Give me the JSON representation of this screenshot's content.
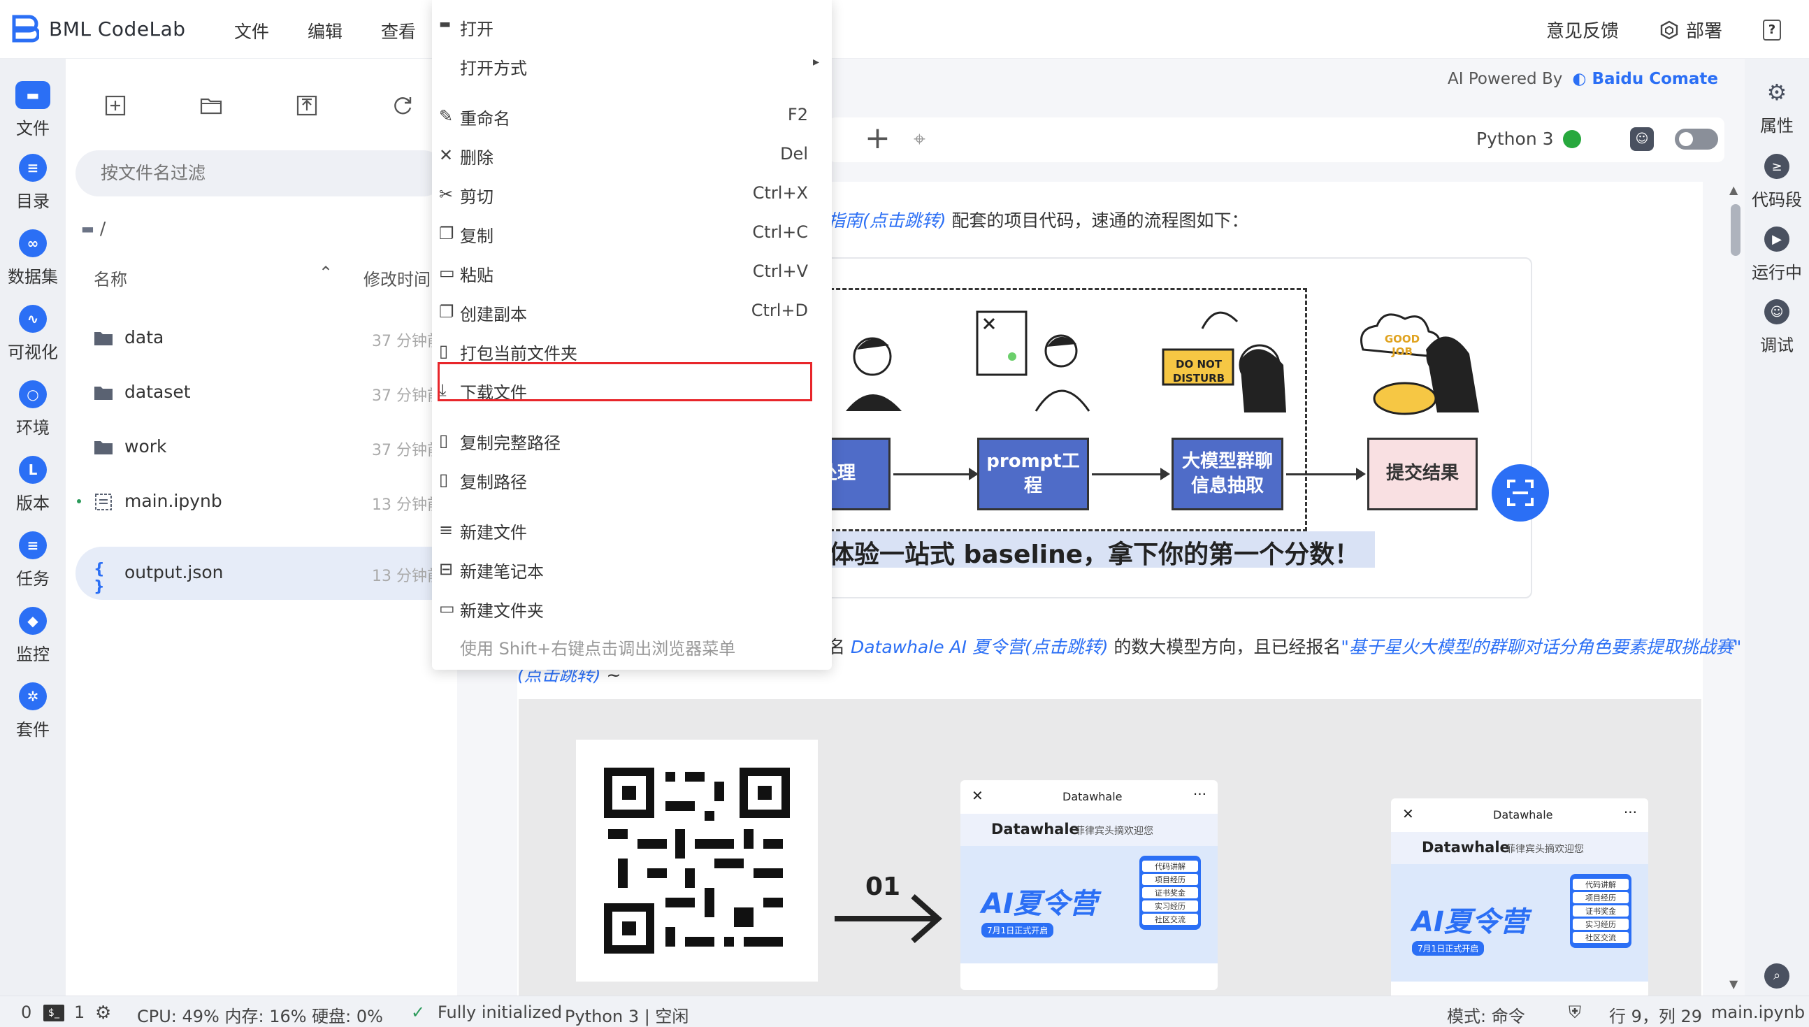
{
  "app": {
    "title": "BML CodeLab"
  },
  "top_menu": [
    "文件",
    "编辑",
    "查看"
  ],
  "top_right": {
    "feedback": "意见反馈",
    "deploy": "部署",
    "help": "?"
  },
  "leftbar": [
    {
      "label": "文件",
      "icon": "folder-icon"
    },
    {
      "label": "目录",
      "icon": "toc-icon"
    },
    {
      "label": "数据集",
      "icon": "dataset-icon"
    },
    {
      "label": "可视化",
      "icon": "chart-icon"
    },
    {
      "label": "环境",
      "icon": "env-icon"
    },
    {
      "label": "版本",
      "icon": "version-icon"
    },
    {
      "label": "任务",
      "icon": "task-icon"
    },
    {
      "label": "监控",
      "icon": "monitor-icon"
    },
    {
      "label": "套件",
      "icon": "suite-icon"
    }
  ],
  "filepanel": {
    "filter_placeholder": "按文件名过滤",
    "path": "/",
    "col_name": "名称",
    "col_mtime": "修改时间",
    "files": [
      {
        "name": "data",
        "type": "folder",
        "mtime": "37 分钟前"
      },
      {
        "name": "dataset",
        "type": "folder",
        "mtime": "37 分钟前"
      },
      {
        "name": "work",
        "type": "folder",
        "mtime": "37 分钟前"
      },
      {
        "name": "main.ipynb",
        "type": "notebook",
        "mtime": "13 分钟前"
      },
      {
        "name": "output.json",
        "type": "json",
        "mtime": "13 分钟前"
      }
    ]
  },
  "context_menu": {
    "items": [
      {
        "label": "打开",
        "shortcut": "",
        "icon": "folder-open-icon"
      },
      {
        "label": "打开方式",
        "shortcut": "",
        "icon": "",
        "submenu": "▸"
      },
      {
        "label": "重命名",
        "shortcut": "F2",
        "icon": "pencil-icon"
      },
      {
        "label": "删除",
        "shortcut": "Del",
        "icon": "close-icon"
      },
      {
        "label": "剪切",
        "shortcut": "Ctrl+X",
        "icon": "scissors-icon"
      },
      {
        "label": "复制",
        "shortcut": "Ctrl+C",
        "icon": "copy-icon"
      },
      {
        "label": "粘贴",
        "shortcut": "Ctrl+V",
        "icon": "paste-icon"
      },
      {
        "label": "创建副本",
        "shortcut": "Ctrl+D",
        "icon": "duplicate-icon"
      },
      {
        "label": "打包当前文件夹",
        "shortcut": "",
        "icon": "package-icon"
      },
      {
        "label": "下载文件",
        "shortcut": "",
        "icon": "download-icon"
      },
      {
        "label": "复制完整路径",
        "shortcut": "",
        "icon": "file-icon"
      },
      {
        "label": "复制路径",
        "shortcut": "",
        "icon": "file-icon"
      },
      {
        "label": "新建文件",
        "shortcut": "",
        "icon": "new-file-icon"
      },
      {
        "label": "新建笔记本",
        "shortcut": "",
        "icon": "new-notebook-icon"
      },
      {
        "label": "新建文件夹",
        "shortcut": "",
        "icon": "new-folder-icon"
      }
    ],
    "hint": "使用 Shift+右键点击调出浏览器菜单"
  },
  "notebook": {
    "ai_powered": "AI Powered By",
    "comate": "Baidu Comate",
    "kernel": "Python 3",
    "line1_link": "指南(点击跳转)",
    "line1_rest": " 配套的项目代码，速通的流程图如下：",
    "flow": {
      "box1": "数据处理",
      "box2": "prompt工程",
      "box3": "大模型群聊\n信息抽取",
      "box4": "提交结果",
      "banner": "体验一站式 baseline，拿下你的第一个分数！",
      "sign": "DO NOT DISTURB",
      "cloud": "GOOD JOB"
    },
    "line2_prefix": "名 ",
    "line2_link1": "Datawhale AI 夏令营(点击跳转)",
    "line2_mid": " 的数大模型方向，且已经报名",
    "line2_link2": "\"基于星火大模型的群聊对话分角色要素提取挑战赛\"",
    "line3_link": "(点击跳转)",
    "line3_rest": "~",
    "step": "01",
    "phone_title": "Datawhale",
    "phone_brand": "Datawhale",
    "phone_welcome": "菲律宾头摘欢迎您",
    "poster_title": "AI夏令营",
    "poster_date": "7月1日正式开启",
    "poster_tags": [
      "代码讲解",
      "项目经历",
      "证书奖金",
      "实习经历",
      "社区交流"
    ]
  },
  "rightbar": [
    {
      "label": "属性",
      "icon": "gear-icon"
    },
    {
      "label": "代码段",
      "icon": "code-snippet-icon"
    },
    {
      "label": "运行中",
      "icon": "running-icon"
    },
    {
      "label": "调试",
      "icon": "debug-icon"
    }
  ],
  "statusbar": {
    "count0": "0",
    "count1": "1",
    "resources": "CPU:  49% 内存:  16% 硬盘:  0%",
    "init": "Fully initialized",
    "kernel_state": "Python 3 | 空闲",
    "mode": "模式:  命令",
    "position": "行 9，列 29",
    "file": "main.ipynb"
  },
  "colors": {
    "accent": "#2b6ff5",
    "highlight": "#e8262b",
    "kernel_ok": "#27a83d"
  }
}
